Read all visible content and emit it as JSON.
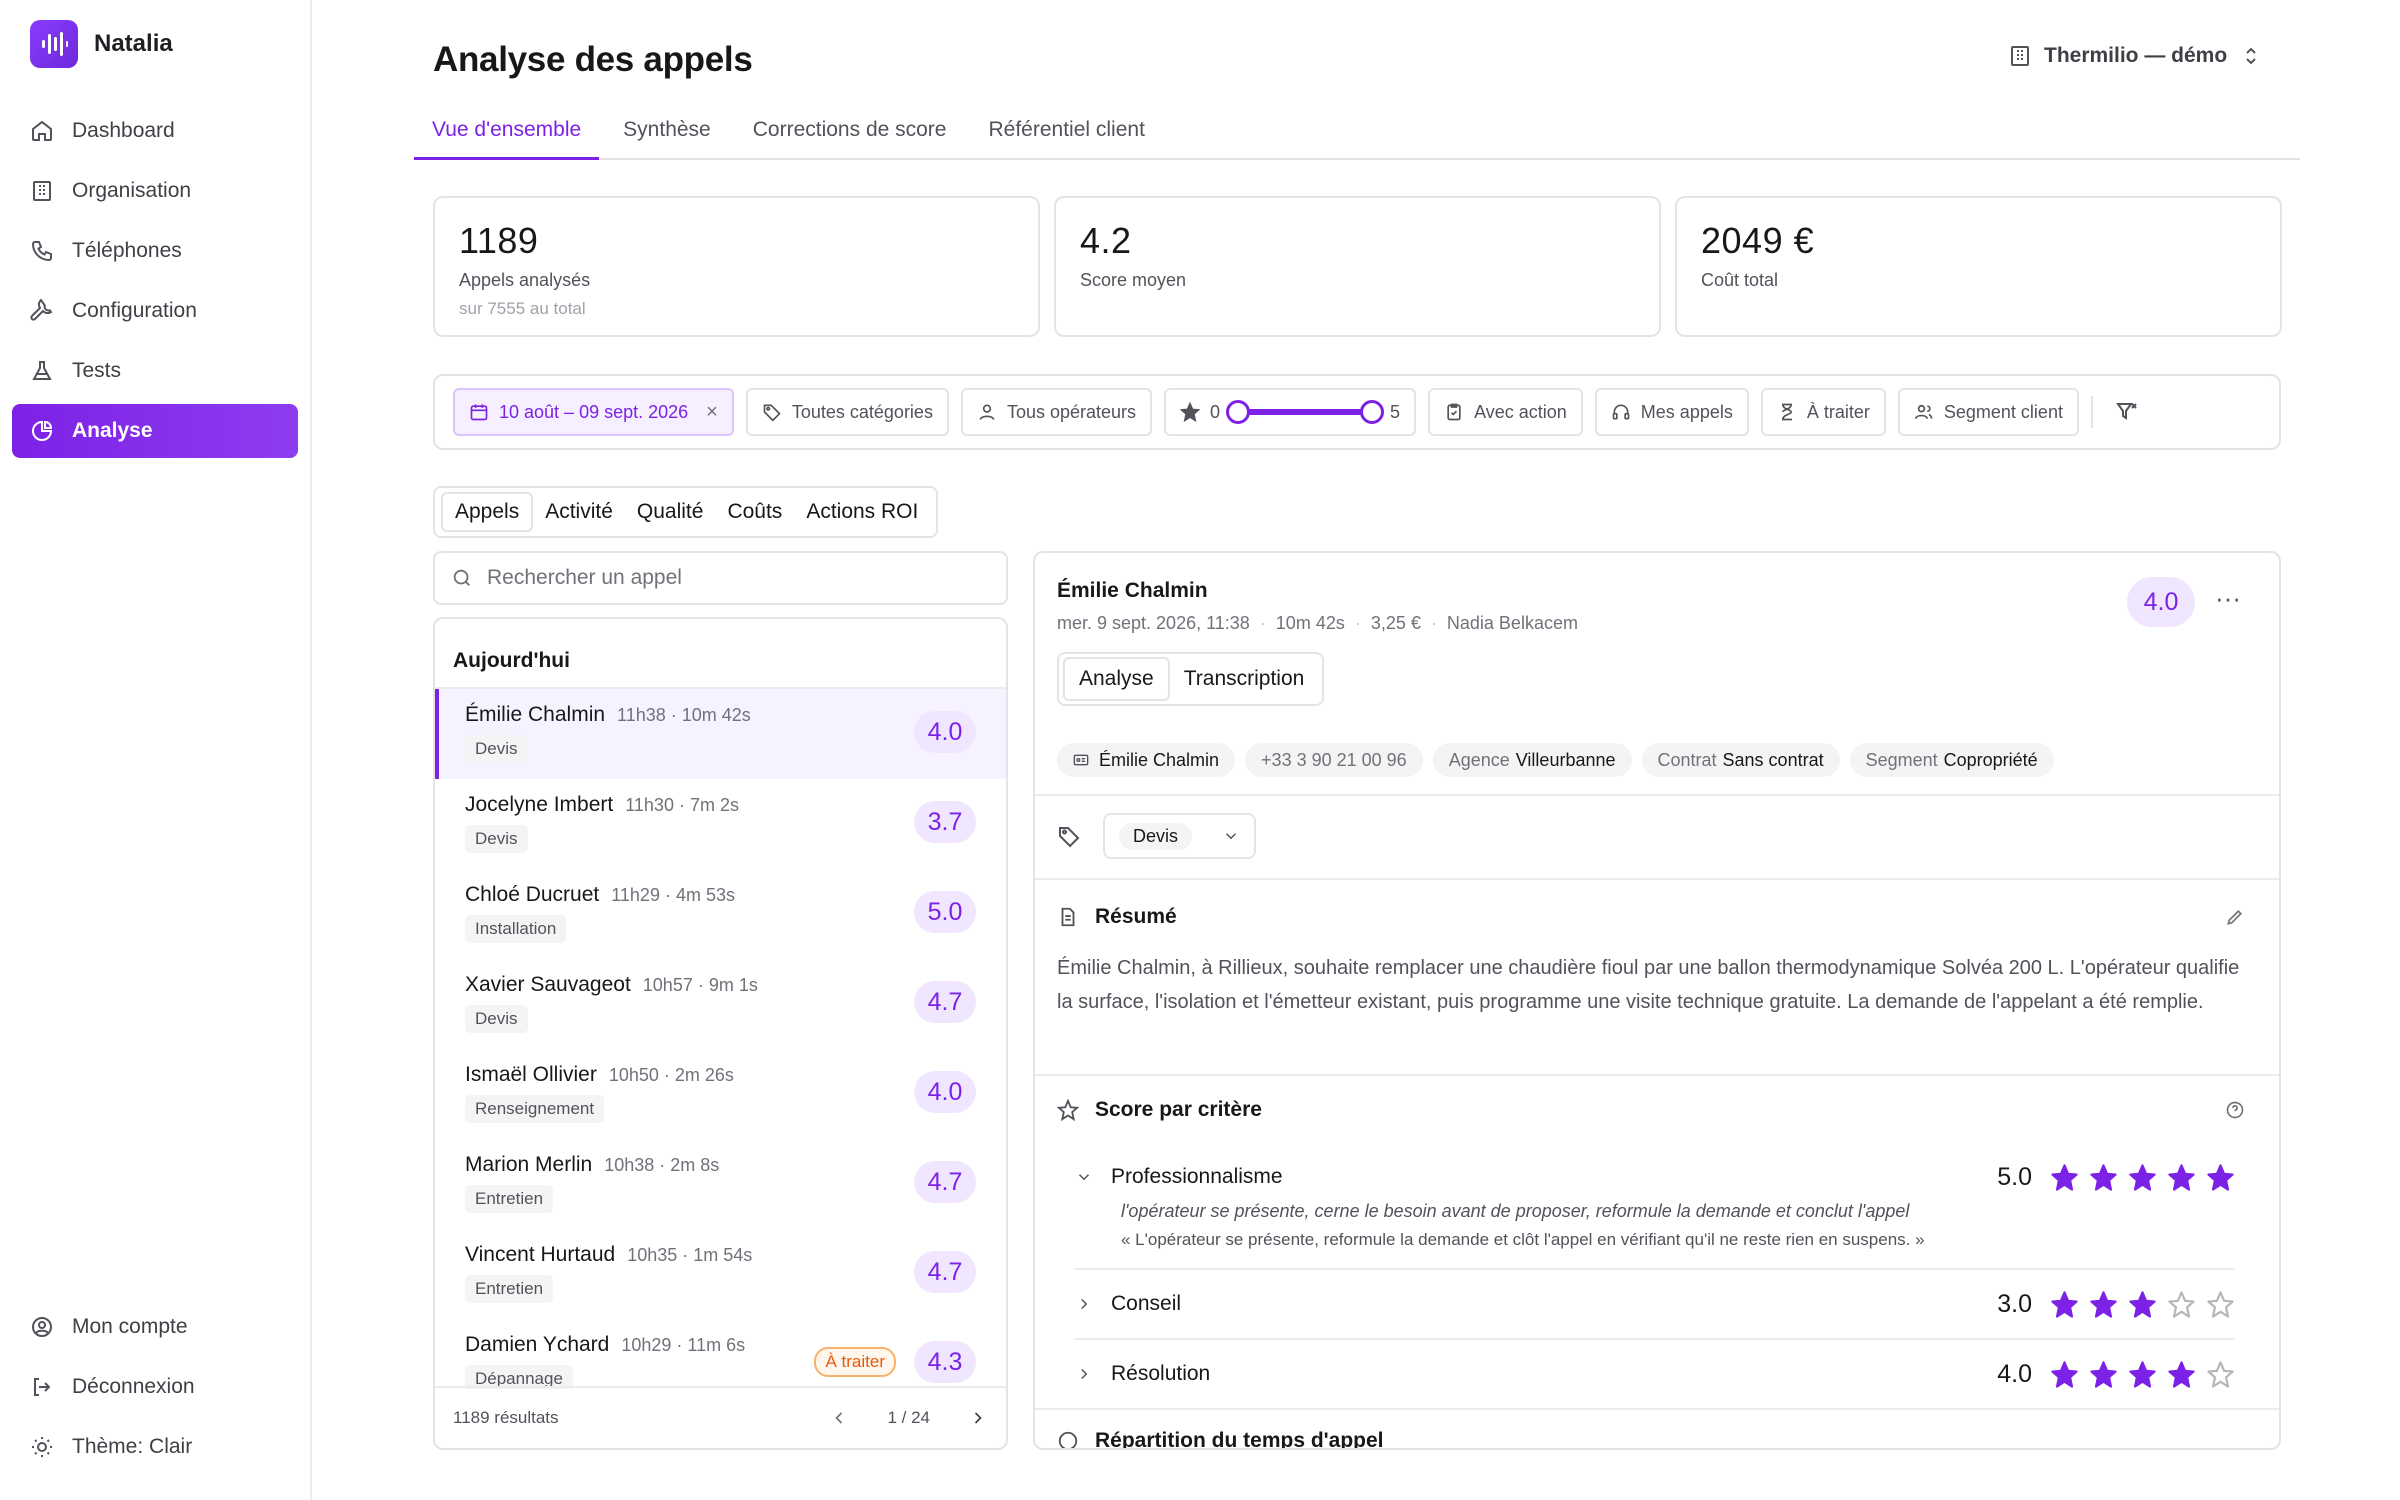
{
  "brand": {
    "name": "Natalia"
  },
  "nav": {
    "items": [
      {
        "label": "Dashboard",
        "icon": "home-icon"
      },
      {
        "label": "Organisation",
        "icon": "building-icon"
      },
      {
        "label": "Téléphones",
        "icon": "phone-icon"
      },
      {
        "label": "Configuration",
        "icon": "wrench-icon"
      },
      {
        "label": "Tests",
        "icon": "flask-icon"
      },
      {
        "label": "Analyse",
        "icon": "pie-chart-icon",
        "active": true
      }
    ],
    "bottom": [
      {
        "label": "Mon compte",
        "icon": "user-circle-icon"
      },
      {
        "label": "Déconnexion",
        "icon": "logout-icon"
      },
      {
        "label": "Thème: Clair",
        "icon": "sun-icon"
      }
    ]
  },
  "header": {
    "title": "Analyse des appels",
    "org": "Thermilio — démo"
  },
  "tabs": [
    "Vue d'ensemble",
    "Synthèse",
    "Corrections de score",
    "Référentiel client"
  ],
  "stats": [
    {
      "value": "1189",
      "label": "Appels analysés",
      "sub": "sur 7555 au total"
    },
    {
      "value": "4.2",
      "label": "Score moyen",
      "sub": ""
    },
    {
      "value": "2049 €",
      "label": "Coût total",
      "sub": ""
    }
  ],
  "filters": {
    "date": "10 août – 09 sept. 2026",
    "categories": "Toutes catégories",
    "operators": "Tous opérateurs",
    "score_min": "0",
    "score_max": "5",
    "with_action": "Avec action",
    "my_calls": "Mes appels",
    "to_process": "À traiter",
    "segment": "Segment client"
  },
  "subtabs": [
    "Appels",
    "Activité",
    "Qualité",
    "Coûts",
    "Actions ROI"
  ],
  "search": {
    "placeholder": "Rechercher un appel"
  },
  "list": {
    "section": "Aujourd'hui",
    "items": [
      {
        "name": "Émilie Chalmin",
        "meta": "11h38 · 10m 42s",
        "tag": "Devis",
        "score": "4.0",
        "badge": ""
      },
      {
        "name": "Jocelyne Imbert",
        "meta": "11h30 · 7m 2s",
        "tag": "Devis",
        "score": "3.7",
        "badge": ""
      },
      {
        "name": "Chloé Ducruet",
        "meta": "11h29 · 4m 53s",
        "tag": "Installation",
        "score": "5.0",
        "badge": ""
      },
      {
        "name": "Xavier Sauvageot",
        "meta": "10h57 · 9m 1s",
        "tag": "Devis",
        "score": "4.7",
        "badge": ""
      },
      {
        "name": "Ismaël Ollivier",
        "meta": "10h50 · 2m 26s",
        "tag": "Renseignement",
        "score": "4.0",
        "badge": ""
      },
      {
        "name": "Marion Merlin",
        "meta": "10h38 · 2m 8s",
        "tag": "Entretien",
        "score": "4.7",
        "badge": ""
      },
      {
        "name": "Vincent Hurtaud",
        "meta": "10h35 · 1m 54s",
        "tag": "Entretien",
        "score": "4.7",
        "badge": ""
      },
      {
        "name": "Damien Ychard",
        "meta": "10h29 · 11m 6s",
        "tag": "Dépannage",
        "score": "4.3",
        "badge": "À traiter"
      }
    ],
    "results": "1189 résultats",
    "page": "1 / 24"
  },
  "detail": {
    "name": "Émilie Chalmin",
    "date": "mer. 9 sept. 2026, 11:38",
    "duration": "10m 42s",
    "cost": "3,25 €",
    "operator": "Nadia Belkacem",
    "score": "4.0",
    "tabs": [
      "Analyse",
      "Transcription"
    ],
    "contact_name": "Émilie Chalmin",
    "phone": "+33 3 90 21 00 96",
    "agence_label": "Agence",
    "agence": "Villeurbanne",
    "contrat_label": "Contrat",
    "contrat": "Sans contrat",
    "segment_label": "Segment",
    "segment": "Copropriété",
    "category": "Devis",
    "summary_title": "Résumé",
    "summary": "Émilie Chalmin, à Rillieux, souhaite remplacer une chaudière fioul par une ballon thermodynamique Solvéa 200 L. L'opérateur qualifie la surface, l'isolation et l'émetteur existant, puis programme une visite technique gratuite. La demande de l'appelant a été remplie.",
    "criteria_title": "Score par critère",
    "criteria": [
      {
        "name": "Professionnalisme",
        "score": "5.0",
        "stars": 5,
        "expanded": true,
        "desc": "l'opérateur se présente, cerne le besoin avant de proposer, reformule la demande et conclut l'appel",
        "quote": "« L'opérateur se présente, reformule la demande et clôt l'appel en vérifiant qu'il ne reste rien en suspens. »"
      },
      {
        "name": "Conseil",
        "score": "3.0",
        "stars": 3,
        "expanded": false
      },
      {
        "name": "Résolution",
        "score": "4.0",
        "stars": 4,
        "expanded": false
      }
    ],
    "time_title": "Répartition du temps d'appel"
  },
  "colors": {
    "accent": "#7c22e6",
    "accent_soft": "#f0e6ff",
    "warn": "#ea580c"
  }
}
